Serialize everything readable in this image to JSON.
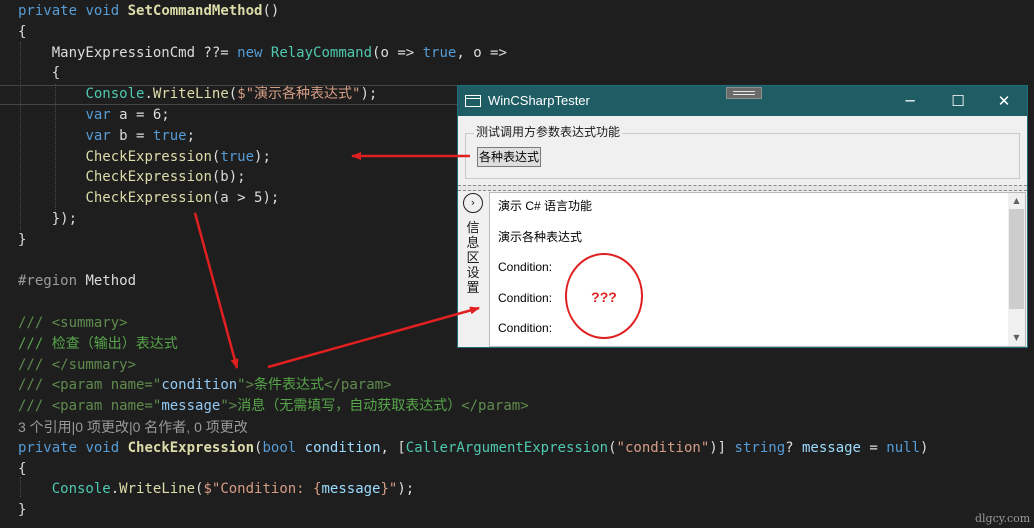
{
  "editor": {
    "lines": [
      {
        "p": [
          {
            "t": "private",
            "c": "kw"
          },
          {
            "t": " "
          },
          {
            "t": "void",
            "c": "kw"
          },
          {
            "t": " "
          },
          {
            "t": "SetCommandMethod",
            "c": "mb"
          },
          {
            "t": "()"
          }
        ]
      },
      {
        "p": [
          {
            "t": "{"
          }
        ]
      },
      {
        "p": [
          {
            "t": "    ManyExpressionCmd ??= "
          },
          {
            "t": "new",
            "c": "kw"
          },
          {
            "t": " "
          },
          {
            "t": "RelayCommand",
            "c": "ty"
          },
          {
            "t": "(o => "
          },
          {
            "t": "true",
            "c": "kw"
          },
          {
            "t": ", o =>"
          }
        ]
      },
      {
        "p": [
          {
            "t": "    {"
          }
        ]
      },
      {
        "p": [
          {
            "t": "        "
          },
          {
            "t": "Console",
            "c": "ty"
          },
          {
            "t": "."
          },
          {
            "t": "WriteLine",
            "c": "mt"
          },
          {
            "t": "("
          },
          {
            "t": "$\"演示各种表达式\"",
            "c": "st"
          },
          {
            "t": ");"
          }
        ]
      },
      {
        "p": [
          {
            "t": "        "
          },
          {
            "t": "var",
            "c": "kw"
          },
          {
            "t": " a = 6;"
          }
        ]
      },
      {
        "p": [
          {
            "t": "        "
          },
          {
            "t": "var",
            "c": "kw"
          },
          {
            "t": " b = "
          },
          {
            "t": "true",
            "c": "kw"
          },
          {
            "t": ";"
          }
        ]
      },
      {
        "p": [
          {
            "t": "        "
          },
          {
            "t": "CheckExpression",
            "c": "mt"
          },
          {
            "t": "("
          },
          {
            "t": "true",
            "c": "kw"
          },
          {
            "t": ");"
          }
        ]
      },
      {
        "p": [
          {
            "t": "        "
          },
          {
            "t": "CheckExpression",
            "c": "mt"
          },
          {
            "t": "(b);"
          }
        ]
      },
      {
        "p": [
          {
            "t": "        "
          },
          {
            "t": "CheckExpression",
            "c": "mt"
          },
          {
            "t": "(a > 5);"
          }
        ]
      },
      {
        "p": [
          {
            "t": "    });"
          }
        ]
      },
      {
        "p": [
          {
            "t": "}"
          }
        ]
      },
      {
        "p": []
      },
      {
        "p": [
          {
            "t": "#region",
            "c": "gy"
          },
          {
            "t": " Method"
          }
        ]
      },
      {
        "p": []
      },
      {
        "p": [
          {
            "t": "/// <summary>",
            "c": "xd"
          }
        ]
      },
      {
        "p": [
          {
            "t": "/// 检查（输出）表达式",
            "c": "cm"
          }
        ]
      },
      {
        "p": [
          {
            "t": "/// </summary>",
            "c": "xd"
          }
        ]
      },
      {
        "p": [
          {
            "t": "/// <param ",
            "c": "xd"
          },
          {
            "t": "name=",
            "c": "xd"
          },
          {
            "t": "\"",
            "c": "xd"
          },
          {
            "t": "condition",
            "c": "xa"
          },
          {
            "t": "\"",
            "c": "xd"
          },
          {
            "t": ">",
            "c": "xd"
          },
          {
            "t": "条件表达式",
            "c": "cm"
          },
          {
            "t": "</param>",
            "c": "xd"
          }
        ]
      },
      {
        "p": [
          {
            "t": "/// <param ",
            "c": "xd"
          },
          {
            "t": "name=",
            "c": "xd"
          },
          {
            "t": "\"",
            "c": "xd"
          },
          {
            "t": "message",
            "c": "xa"
          },
          {
            "t": "\"",
            "c": "xd"
          },
          {
            "t": ">",
            "c": "xd"
          },
          {
            "t": "消息（无需填写，自动获取表达式）",
            "c": "cm"
          },
          {
            "t": "</param>",
            "c": "xd"
          }
        ]
      },
      {
        "lens": true,
        "p": [
          {
            "t": "3 个引用|0 项更改|0 名作者, 0 项更改"
          }
        ]
      },
      {
        "p": [
          {
            "t": "private",
            "c": "kw"
          },
          {
            "t": " "
          },
          {
            "t": "void",
            "c": "kw"
          },
          {
            "t": " "
          },
          {
            "t": "CheckExpression",
            "c": "mb"
          },
          {
            "t": "("
          },
          {
            "t": "bool",
            "c": "kw"
          },
          {
            "t": " "
          },
          {
            "t": "condition",
            "c": "pa"
          },
          {
            "t": ", ["
          },
          {
            "t": "CallerArgumentExpression",
            "c": "ty"
          },
          {
            "t": "("
          },
          {
            "t": "\"condition\"",
            "c": "st"
          },
          {
            "t": ")] "
          },
          {
            "t": "string",
            "c": "kw"
          },
          {
            "t": "? "
          },
          {
            "t": "message",
            "c": "pa"
          },
          {
            "t": " = "
          },
          {
            "t": "null",
            "c": "kw"
          },
          {
            "t": ")"
          }
        ]
      },
      {
        "p": [
          {
            "t": "{"
          }
        ]
      },
      {
        "p": [
          {
            "t": "    "
          },
          {
            "t": "Console",
            "c": "ty"
          },
          {
            "t": "."
          },
          {
            "t": "WriteLine",
            "c": "mt"
          },
          {
            "t": "("
          },
          {
            "t": "$\"Condition: {",
            "c": "st"
          },
          {
            "t": "message",
            "c": "pa"
          },
          {
            "t": "}\"",
            "c": "st"
          },
          {
            "t": ");"
          }
        ]
      },
      {
        "p": [
          {
            "t": "}"
          }
        ]
      }
    ]
  },
  "window": {
    "title": "WinCSharpTester",
    "minimize_glyph": "─",
    "maximize_glyph": "☐",
    "close_glyph": "✕",
    "group_title": "测试调用方参数表达式功能",
    "demo_button_label": "各种表达式",
    "collapse_glyph": "›",
    "side_label": "信息区设置",
    "scroll_up_glyph": "▲",
    "scroll_down_glyph": "▼",
    "info_lines": [
      "演示 C# 语言功能",
      "演示各种表达式",
      "Condition:",
      "Condition:",
      "Condition:"
    ]
  },
  "annotations": {
    "question_marks": "???",
    "arrow_color": "#e02020"
  },
  "watermark": "dlgcy.com"
}
